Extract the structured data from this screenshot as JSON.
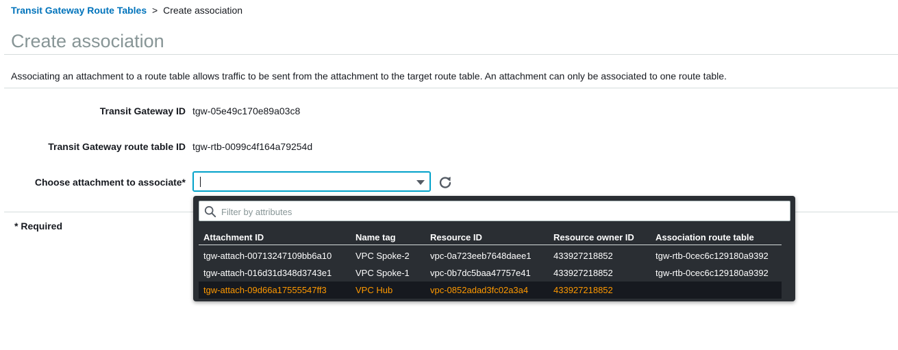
{
  "breadcrumb": {
    "link_label": "Transit Gateway Route Tables",
    "separator": ">",
    "current": "Create association"
  },
  "page": {
    "title": "Create association",
    "description": "Associating an attachment to a route table allows traffic to be sent from the attachment to the target route table. An attachment can only be associated to one route table."
  },
  "form": {
    "transit_gateway_id_label": "Transit Gateway ID",
    "transit_gateway_id_value": "tgw-05e49c170e89a03c8",
    "route_table_id_label": "Transit Gateway route table ID",
    "route_table_id_value": "tgw-rtb-0099c4f164a79254d",
    "attachment_label": "Choose attachment to associate*",
    "attachment_value": "",
    "required_note": "* Required"
  },
  "dropdown": {
    "filter_placeholder": "Filter by attributes",
    "columns": [
      "Attachment ID",
      "Name tag",
      "Resource ID",
      "Resource owner ID",
      "Association route table"
    ],
    "rows": [
      {
        "attachment_id": "tgw-attach-00713247109bb6a10",
        "name_tag": "VPC Spoke-2",
        "resource_id": "vpc-0a723eeb7648daee1",
        "owner_id": "433927218852",
        "route_table": "tgw-rtb-0cec6c129180a9392",
        "selected": false
      },
      {
        "attachment_id": "tgw-attach-016d31d348d3743e1",
        "name_tag": "VPC Spoke-1",
        "resource_id": "vpc-0b7dc5baa47757e41",
        "owner_id": "433927218852",
        "route_table": "tgw-rtb-0cec6c129180a9392",
        "selected": false
      },
      {
        "attachment_id": "tgw-attach-09d66a17555547ff3",
        "name_tag": "VPC Hub",
        "resource_id": "vpc-0852adad3fc02a3a4",
        "owner_id": "433927218852",
        "route_table": "",
        "selected": true
      }
    ]
  },
  "icons": {
    "search": "search-icon",
    "refresh": "refresh-icon",
    "dropdown": "chevron-down-icon"
  },
  "colors": {
    "link": "#0073bb",
    "focus_border": "#00a1c9",
    "dropdown_bg": "#2a2e33",
    "selected_text": "#ff9900"
  }
}
